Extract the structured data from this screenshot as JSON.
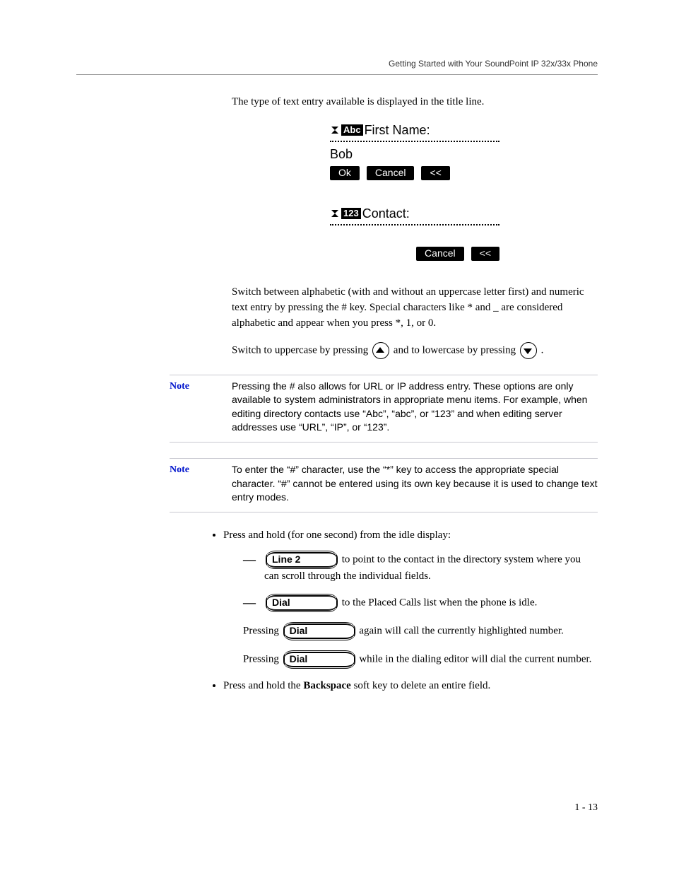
{
  "header": "Getting Started with Your SoundPoint IP 32x/33x Phone",
  "intro": "The type of text entry available is displayed in the title line.",
  "lcd1": {
    "mode_badge": "Abc",
    "title": "First Name:",
    "value": "Bob",
    "keys": {
      "ok": "Ok",
      "cancel": "Cancel",
      "bksp": "<<"
    }
  },
  "lcd2": {
    "mode_badge": "123",
    "title": "Contact:",
    "keys": {
      "cancel": "Cancel",
      "bksp": "<<"
    }
  },
  "para_switch_modes": "Switch between alphabetic (with and without an uppercase letter first) and numeric text entry by pressing the # key. Special characters like * and _ are considered alphabetic and appear when you press *, 1, or 0.",
  "para_switch_case_a": "Switch to uppercase by pressing ",
  "para_switch_case_b": " and to lowercase by pressing ",
  "period": " .",
  "note_label": "Note",
  "note1": "Pressing the # also allows for URL or IP address entry. These options are only available to system administrators in appropriate menu items. For example, when editing directory contacts use “Abc”, “abc”, or “123” and when editing server addresses use “URL”, “IP”, or “123”.",
  "note2": "To enter the “#” character, use the “*” key to access the appropriate special character. “#” cannot be entered using its own key because it is used to change text entry modes.",
  "bullet1": "Press and hold (for one second) from the idle display:",
  "keys": {
    "line2": "Line 2",
    "dial": "Dial"
  },
  "dash1_after": " to point to the contact in the directory system where you can scroll through the individual fields.",
  "dash2_after": " to the Placed Calls list when the phone is idle.",
  "dial_again_a": "Pressing ",
  "dial_again_b": " again will call the currently highlighted number.",
  "dial_editor_a": "Pressing ",
  "dial_editor_b": " while in the dialing editor will dial the current number.",
  "bullet2_a": "Press and hold the ",
  "bullet2_bold": "Backspace",
  "bullet2_b": " soft key to delete an entire field.",
  "page_number": "1 - 13"
}
